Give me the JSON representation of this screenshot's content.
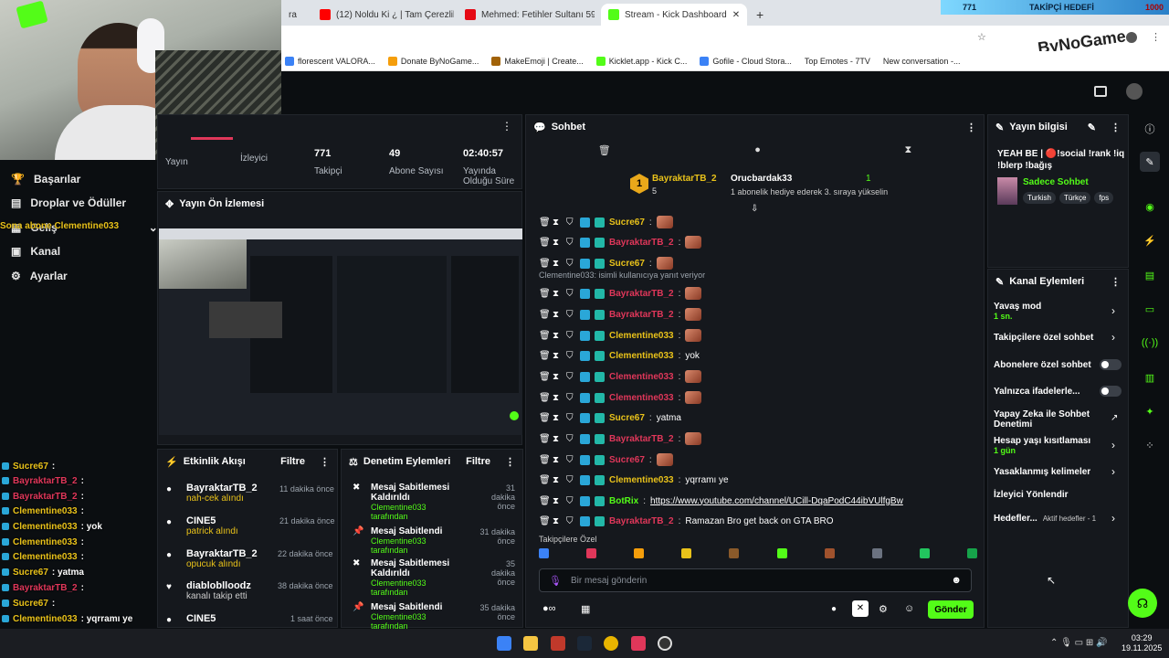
{
  "browser": {
    "tabs": [
      {
        "label": "ra",
        "color": "#ccc"
      },
      {
        "label": "(12) Noldu Ki ¿ | Tam Çerezlik |",
        "color": "#ff0000"
      },
      {
        "label": "Mehmed: Fetihler Sultanı 59. Bö",
        "color": "#e50914"
      },
      {
        "label": "Stream - Kick Dashboard",
        "color": "#53fc18"
      }
    ],
    "new_tab": "+",
    "bookmarks": [
      {
        "label": "florescent VALORA...",
        "color": "#3b82f6"
      },
      {
        "label": "Donate ByNoGame...",
        "color": "#f59e0b"
      },
      {
        "label": "MakeEmoji | Create...",
        "color": "#a16207"
      },
      {
        "label": "Kicklet.app - Kick C...",
        "color": "#53fc18"
      },
      {
        "label": "Gofile - Cloud Stora...",
        "color": "#3b82f6"
      },
      {
        "label": "Top Emotes - 7TV",
        "color": "#555"
      },
      {
        "label": "New conversation -...",
        "color": "#555"
      }
    ]
  },
  "overlay": {
    "goal_count": "771",
    "goal_label": "TAKİPÇİ HEDEFİ",
    "goal_target": "1000",
    "brand": "ByNoGame"
  },
  "sidebar": {
    "items": [
      {
        "label": "Başarılar",
        "icon": "trophy-icon"
      },
      {
        "label": "Droplar ve Ödüller",
        "icon": "gift-icon"
      },
      {
        "label": "Geliş",
        "icon": "chart-icon"
      },
      {
        "label": "Kanal",
        "icon": "channel-icon"
      },
      {
        "label": "Ayarlar",
        "icon": "gear-icon"
      }
    ],
    "sub_alert": "Sona abone Clementine033"
  },
  "stats": [
    {
      "value": "",
      "label": "Yayın"
    },
    {
      "value": "",
      "label": "İzleyici"
    },
    {
      "value": "771",
      "label": "Takipçi"
    },
    {
      "value": "49",
      "label": "Abone Sayısı"
    },
    {
      "value": "02:40:57",
      "label": "Yayında Olduğu Süre"
    }
  ],
  "preview": {
    "title": "Yayın Ön İzlemesi"
  },
  "activity": {
    "title": "Etkinlik Akışı",
    "filter": "Filtre",
    "items": [
      {
        "user": "BayraktarTB_2",
        "detail": "nah-cek alındı",
        "time": "11 dakika önce"
      },
      {
        "user": "CINE5",
        "detail": "patrick alındı",
        "time": "21 dakika önce"
      },
      {
        "user": "BayraktarTB_2",
        "detail": "opucuk alındı",
        "time": "22 dakika önce"
      },
      {
        "user": "diabloblloodz",
        "detail": "kanalı takip etti",
        "time": "38 dakika önce"
      },
      {
        "user": "CINE5",
        "detail": "",
        "time": "1 saat önce"
      }
    ]
  },
  "moderation": {
    "title": "Denetim Eylemleri",
    "filter": "Filtre",
    "items": [
      {
        "action": "Mesaj Sabitlemesi Kaldırıldı",
        "by": "Clementine033 tarafından",
        "time": "31 dakika önce"
      },
      {
        "action": "Mesaj Sabitlendi",
        "by": "Clementine033 tarafından",
        "time": "31 dakika önce"
      },
      {
        "action": "Mesaj Sabitlemesi Kaldırıldı",
        "by": "Clementine033 tarafından",
        "time": "35 dakika önce"
      },
      {
        "action": "Mesaj Sabitlendi",
        "by": "Clementine033 tarafından",
        "time": "35 dakika önce"
      }
    ]
  },
  "chat": {
    "title": "Sohbet",
    "top_gifter": {
      "rank": "1",
      "user": "BayraktarTB_2",
      "count": "5"
    },
    "second": {
      "user": "Orucbardak33",
      "count": "1",
      "detail": "1 abonelik hediye ederek 3. sıraya yükselin"
    },
    "reply_hint": "Clementine033: isimli kullanıcıya yanıt veriyor",
    "messages": [
      {
        "user": "Sucre67",
        "text": "",
        "color": "yel"
      },
      {
        "user": "BayraktarTB_2",
        "text": "",
        "color": "red"
      },
      {
        "user": "Sucre67",
        "text": "",
        "color": "yel"
      },
      {
        "user": "BayraktarTB_2",
        "text": "",
        "color": "red"
      },
      {
        "user": "BayraktarTB_2",
        "text": "",
        "color": "red"
      },
      {
        "user": "Clementine033",
        "text": "",
        "color": "yel"
      },
      {
        "user": "Clementine033",
        "text": "yok",
        "color": "yel"
      },
      {
        "user": "Clementine033",
        "text": "",
        "color": "red"
      },
      {
        "user": "Clementine033",
        "text": "",
        "color": "red"
      },
      {
        "user": "Sucre67",
        "text": "yatma",
        "color": "yel"
      },
      {
        "user": "BayraktarTB_2",
        "text": "",
        "color": "red"
      },
      {
        "user": "Sucre67",
        "text": "",
        "color": "red"
      },
      {
        "user": "Clementine033",
        "text": "yqrramı ye",
        "color": "yel"
      },
      {
        "user": "BotRix",
        "text": "https://www.youtube.com/channel/UCill-DqaPodC44ibVUlfgBw",
        "color": "grn"
      },
      {
        "user": "BayraktarTB_2",
        "text": "Ramazan Bro get back on GTA BRO",
        "color": "red"
      }
    ],
    "followers_only": "Takipçilere Özel",
    "input_placeholder": "Bir mesaj gönderin",
    "send": "Gönder"
  },
  "stream_info": {
    "title": "Yayın bilgisi",
    "stream_title": "YEAH BE | 🔴!social !rank !iq !blerp !bağış",
    "category": "Sadece Sohbet",
    "tags": [
      "Turkish",
      "Türkçe",
      "fps"
    ]
  },
  "channel_actions": {
    "title": "Kanal Eylemleri",
    "items": [
      {
        "label": "Yavaş mod",
        "sub": "1 sn."
      },
      {
        "label": "Takipçilere özel sohbet",
        "sub": ""
      },
      {
        "label": "Abonelere özel sohbet",
        "sub": ""
      },
      {
        "label": "Yalnızca ifadelerle...",
        "sub": ""
      },
      {
        "label": "Yapay Zeka ile Sohbet Denetimi",
        "sub": ""
      },
      {
        "label": "Hesap yaşı kısıtlaması",
        "sub": "1 gün"
      },
      {
        "label": "Yasaklanmış kelimeler",
        "sub": ""
      },
      {
        "label": "İzleyici Yönlendir",
        "sub": ""
      },
      {
        "label": "Hedefler...",
        "sub": "Aktif hedefler - 1"
      }
    ]
  },
  "overlay_chat": [
    {
      "user": "Sucre67",
      "text": ":",
      "color": "#e9c21a"
    },
    {
      "user": "BayraktarTB_2",
      "text": ":",
      "color": "#e0375a"
    },
    {
      "user": "BayraktarTB_2",
      "text": ":",
      "color": "#e0375a"
    },
    {
      "user": "Clementine033",
      "text": ":",
      "color": "#e9c21a"
    },
    {
      "user": "Clementine033",
      "text": ": yok",
      "color": "#e9c21a"
    },
    {
      "user": "Clementine033",
      "text": ":",
      "color": "#e9c21a"
    },
    {
      "user": "Clementine033",
      "text": ":",
      "color": "#e9c21a"
    },
    {
      "user": "Sucre67",
      "text": ": yatma",
      "color": "#e9c21a"
    },
    {
      "user": "BayraktarTB_2",
      "text": ":",
      "color": "#e0375a"
    },
    {
      "user": "Sucre67",
      "text": ":",
      "color": "#e9c21a"
    },
    {
      "user": "Clementine033",
      "text": ": yqrramı ye",
      "color": "#e9c21a"
    },
    {
      "user": "BotRix",
      "text": ": https://www.youtube.com/channel/UCill-DqaPodC44ibVUlfgBw",
      "color": "#53fc18"
    },
    {
      "user": "BayraktarTB_2",
      "text": ": Ramazan Bro get back on GTA BRO",
      "color": "#e0375a"
    }
  ],
  "taskbar": {
    "time": "03:29",
    "date": "19.11.2025"
  }
}
